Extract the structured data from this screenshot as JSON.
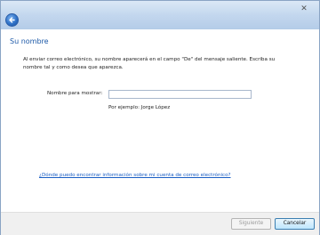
{
  "window": {
    "close_glyph": "✕",
    "back_icon": "back-arrow-icon"
  },
  "page": {
    "heading": "Su nombre",
    "description": "Al enviar correo electrónico, su nombre aparecerá en el campo \"De\" del mensaje saliente. Escriba su nombre tal y como desea que aparezca.",
    "display_name_label": "Nombre para mostrar:",
    "display_name_value": "",
    "example": "Por ejemplo: Jorge López",
    "help_link": "¿Dónde puedo encontrar información sobre mi cuenta de correo electrónico?"
  },
  "footer": {
    "next_label": "Siguiente",
    "cancel_label": "Cancelar"
  },
  "colors": {
    "heading": "#1e5aa8",
    "link": "#1a5ec4",
    "titlebar": "#c3d7ee"
  }
}
